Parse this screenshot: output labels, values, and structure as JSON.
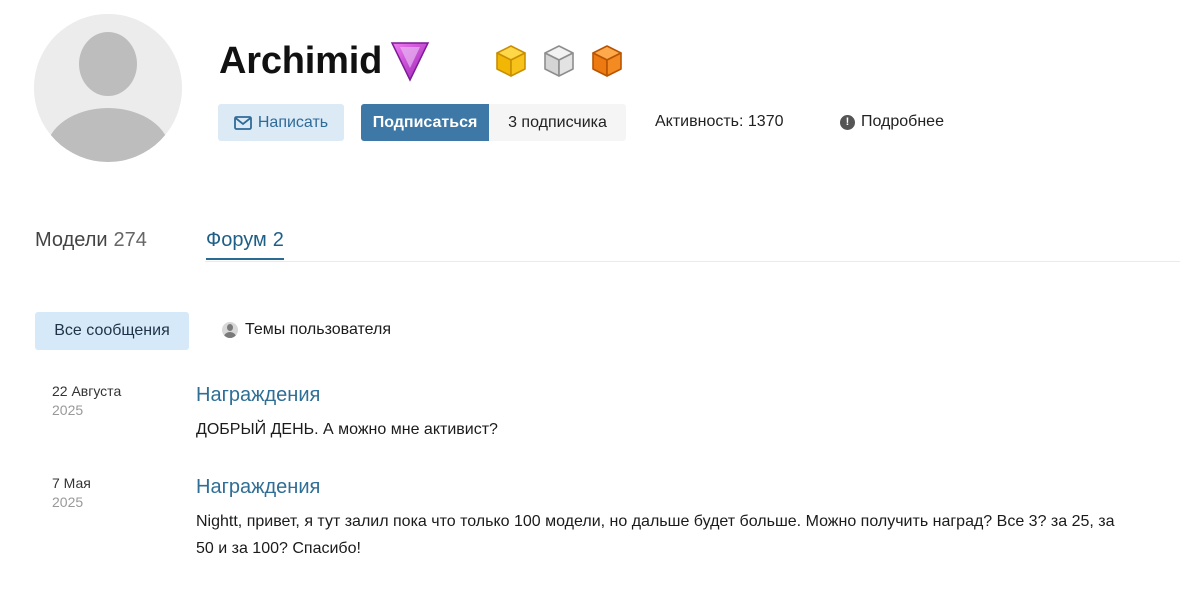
{
  "profile": {
    "username": "Archimid",
    "rank_icon": "purple-triangle-gem-icon",
    "badges": [
      {
        "icon": "cube-icon",
        "color": "#f2b705"
      },
      {
        "icon": "cube-icon",
        "color": "#b8b8b8"
      },
      {
        "icon": "cube-icon",
        "color": "#ec7a10"
      }
    ],
    "write_label": "Написать",
    "subscribe_label": "Подписаться",
    "subscribers_label": "3 подписчика",
    "activity_label": "Активность: 1370",
    "more_label": "Подробнее"
  },
  "tabs": [
    {
      "label": "Модели",
      "count": "274"
    },
    {
      "label": "Форум",
      "count": "2"
    }
  ],
  "filters": {
    "all_label": "Все сообщения",
    "user_topics_label": "Темы пользователя"
  },
  "posts": [
    {
      "day": "22 Августа",
      "year": "2025",
      "title": "Награждения",
      "text": "ДОБРЫЙ ДЕНЬ. А можно мне  активист?"
    },
    {
      "day": "7 Мая",
      "year": "2025",
      "title": "Награждения",
      "text": "Nightt, привет, я тут залил пока что только 100 модели, но дальше будет больше. Можно получить наград? Все 3? за 25, за 50 и за 100? Спасибо!"
    }
  ],
  "colors": {
    "accent": "#3e78a6",
    "link": "#2f6e95",
    "write_button_bg": "#dceaf6",
    "filter_active_bg": "#d6e9f8"
  }
}
